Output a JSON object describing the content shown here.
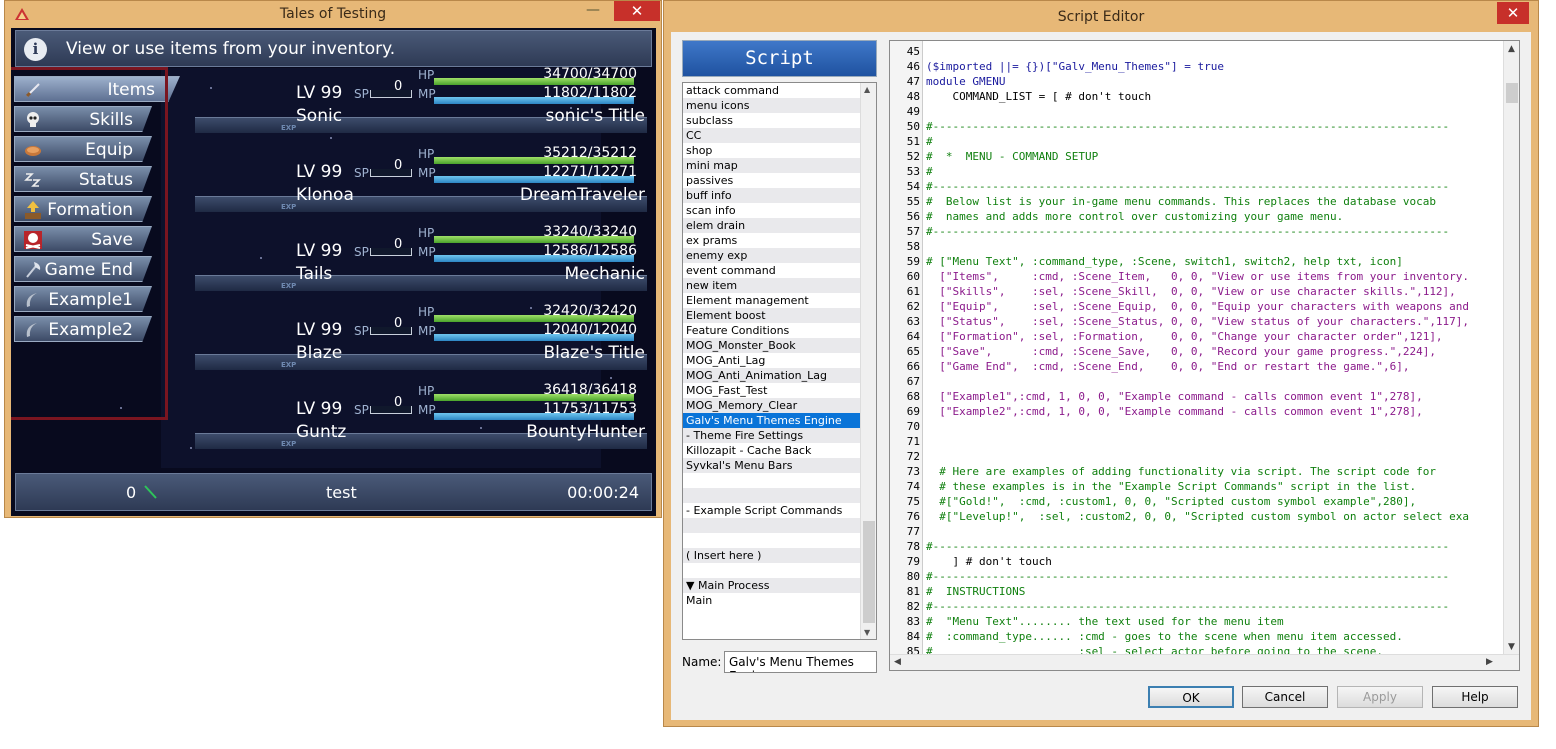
{
  "game_window": {
    "title": "Tales of Testing",
    "min_glyph": "—",
    "close_glyph": "✕",
    "help_text": "View or use items from your inventory.",
    "info_glyph": "i",
    "commands": [
      {
        "label": "Items",
        "icon": "sword-icon",
        "selected": true
      },
      {
        "label": "Skills",
        "icon": "skull-icon",
        "selected": false
      },
      {
        "label": "Equip",
        "icon": "bread-icon",
        "selected": false
      },
      {
        "label": "Status",
        "icon": "sleep-icon",
        "selected": false
      },
      {
        "label": "Formation",
        "icon": "def-up-icon",
        "selected": false
      },
      {
        "label": "Save",
        "icon": "skull-crossbones-icon",
        "selected": false
      },
      {
        "label": "Game End",
        "icon": "axe-icon",
        "selected": false
      },
      {
        "label": "Example1",
        "icon": "sickle-icon",
        "selected": false
      },
      {
        "label": "Example2",
        "icon": "sickle-icon",
        "selected": false
      }
    ],
    "actors": [
      {
        "name": "Sonic",
        "title": "sonic's Title",
        "level": "LV 99",
        "sp": "0",
        "hp": "34700/34700",
        "mp": "11802/11802",
        "hp_fill": 1.0,
        "mp_fill": 1.0
      },
      {
        "name": "Klonoa",
        "title": "DreamTraveler",
        "level": "LV 99",
        "sp": "0",
        "hp": "35212/35212",
        "mp": "12271/12271",
        "hp_fill": 1.0,
        "mp_fill": 1.0
      },
      {
        "name": "Tails",
        "title": "Mechanic",
        "level": "LV 99",
        "sp": "0",
        "hp": "33240/33240",
        "mp": "12586/12586",
        "hp_fill": 1.0,
        "mp_fill": 1.0
      },
      {
        "name": "Blaze",
        "title": "Blaze's Title",
        "level": "LV 99",
        "sp": "0",
        "hp": "32420/32420",
        "mp": "12040/12040",
        "hp_fill": 1.0,
        "mp_fill": 1.0
      },
      {
        "name": "Guntz",
        "title": "BountyHunter",
        "level": "LV 99",
        "sp": "0",
        "hp": "36418/36418",
        "mp": "11753/11753",
        "hp_fill": 1.0,
        "mp_fill": 1.0
      }
    ],
    "labels": {
      "sp": "SP",
      "hp": "HP",
      "mp": "MP",
      "exp": "EXP"
    },
    "gold": "0",
    "map_name": "test",
    "playtime": "00:00:24"
  },
  "script_editor": {
    "title": "Script Editor",
    "close_glyph": "✕",
    "header": "Script",
    "scripts": [
      "attack command",
      "menu icons",
      "subclass",
      "CC",
      "shop",
      "mini map",
      "passives",
      "buff info",
      "scan info",
      "elem drain",
      "ex prams",
      "enemy exp",
      "event command",
      "new item",
      "Element management",
      "Element boost",
      "Feature Conditions",
      "MOG_Monster_Book",
      "MOG_Anti_Lag",
      "MOG_Anti_Animation_Lag",
      "MOG_Fast_Test",
      "MOG_Memory_Clear",
      "Galv's Menu Themes Engine",
      "- Theme Fire Settings",
      "Killozapit - Cache Back",
      "Syvkal's Menu Bars",
      "",
      "",
      "- Example Script Commands",
      "",
      "",
      "( Insert here )",
      "",
      "▼ Main Process",
      "Main"
    ],
    "selected_index": 22,
    "name_label": "Name:",
    "name_value": "Galv's Menu Themes Engine",
    "code_lines": [
      {
        "n": "45",
        "t": "",
        "c": ""
      },
      {
        "n": "46",
        "t": "($imported ||= {})[\"Galv_Menu_Themes\"] = true",
        "c": "k"
      },
      {
        "n": "47",
        "t": "module GMENU",
        "c": "k"
      },
      {
        "n": "48",
        "t": "    COMMAND_LIST = [ # don't touch",
        "c": ""
      },
      {
        "n": "49",
        "t": "",
        "c": ""
      },
      {
        "n": "50",
        "t": "#------------------------------------------------------------------------------",
        "c": "c"
      },
      {
        "n": "51",
        "t": "#",
        "c": "c"
      },
      {
        "n": "52",
        "t": "#  *  MENU - COMMAND SETUP",
        "c": "c"
      },
      {
        "n": "53",
        "t": "#",
        "c": "c"
      },
      {
        "n": "54",
        "t": "#------------------------------------------------------------------------------",
        "c": "c"
      },
      {
        "n": "55",
        "t": "#  Below list is your in-game menu commands. This replaces the database vocab",
        "c": "c"
      },
      {
        "n": "56",
        "t": "#  names and adds more control over customizing your game menu.",
        "c": "c"
      },
      {
        "n": "57",
        "t": "#------------------------------------------------------------------------------",
        "c": "c"
      },
      {
        "n": "58",
        "t": "",
        "c": ""
      },
      {
        "n": "59",
        "t": "# [\"Menu Text\", :command_type, :Scene, switch1, switch2, help txt, icon]",
        "c": "c"
      },
      {
        "n": "60",
        "t": "  [\"Items\",     :cmd, :Scene_Item,   0, 0, \"View or use items from your inventory.",
        "c": "s"
      },
      {
        "n": "61",
        "t": "  [\"Skills\",    :sel, :Scene_Skill,  0, 0, \"View or use character skills.\",112],",
        "c": "s"
      },
      {
        "n": "62",
        "t": "  [\"Equip\",     :sel, :Scene_Equip,  0, 0, \"Equip your characters with weapons and",
        "c": "s"
      },
      {
        "n": "63",
        "t": "  [\"Status\",    :sel, :Scene_Status, 0, 0, \"View status of your characters.\",117],",
        "c": "s"
      },
      {
        "n": "64",
        "t": "  [\"Formation\", :sel, :Formation,    0, 0, \"Change your character order\",121],",
        "c": "s"
      },
      {
        "n": "65",
        "t": "  [\"Save\",      :cmd, :Scene_Save,   0, 0, \"Record your game progress.\",224],",
        "c": "s"
      },
      {
        "n": "66",
        "t": "  [\"Game End\",  :cmd, :Scene_End,    0, 0, \"End or restart the game.\",6],",
        "c": "s"
      },
      {
        "n": "67",
        "t": "",
        "c": ""
      },
      {
        "n": "68",
        "t": "  [\"Example1\",:cmd, 1, 0, 0, \"Example command - calls common event 1\",278],",
        "c": "s"
      },
      {
        "n": "69",
        "t": "  [\"Example2\",:cmd, 1, 0, 0, \"Example command - calls common event 1\",278],",
        "c": "s"
      },
      {
        "n": "70",
        "t": "",
        "c": ""
      },
      {
        "n": "71",
        "t": "",
        "c": ""
      },
      {
        "n": "72",
        "t": "",
        "c": ""
      },
      {
        "n": "73",
        "t": "  # Here are examples of adding functionality via script. The script code for",
        "c": "c"
      },
      {
        "n": "74",
        "t": "  # these examples is in the \"Example Script Commands\" script in the list.",
        "c": "c"
      },
      {
        "n": "75",
        "t": "  #[\"Gold!\",  :cmd, :custom1, 0, 0, \"Scripted custom symbol example\",280],",
        "c": "c"
      },
      {
        "n": "76",
        "t": "  #[\"Levelup!\",  :sel, :custom2, 0, 0, \"Scripted custom symbol on actor select exa",
        "c": "c"
      },
      {
        "n": "77",
        "t": "",
        "c": ""
      },
      {
        "n": "78",
        "t": "#------------------------------------------------------------------------------",
        "c": "c"
      },
      {
        "n": "79",
        "t": "    ] # don't touch",
        "c": ""
      },
      {
        "n": "80",
        "t": "#------------------------------------------------------------------------------",
        "c": "c"
      },
      {
        "n": "81",
        "t": "#  INSTRUCTIONS",
        "c": "c"
      },
      {
        "n": "82",
        "t": "#------------------------------------------------------------------------------",
        "c": "c"
      },
      {
        "n": "83",
        "t": "#  \"Menu Text\"........ the text used for the menu item",
        "c": "c"
      },
      {
        "n": "84",
        "t": "#  :command_type...... :cmd - goes to the scene when menu item accessed.",
        "c": "c"
      },
      {
        "n": "85",
        "t": "#                      :sel - select actor before going to the scene.",
        "c": "c"
      }
    ],
    "buttons": {
      "ok": "OK",
      "cancel": "Cancel",
      "apply": "Apply",
      "help": "Help"
    }
  }
}
